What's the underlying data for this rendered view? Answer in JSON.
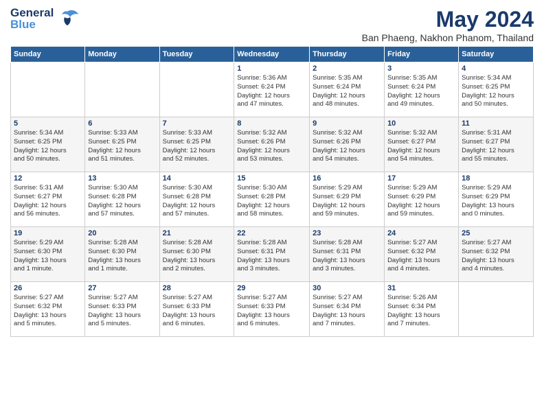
{
  "header": {
    "logo_line1": "General",
    "logo_line2": "Blue",
    "month_year": "May 2024",
    "location": "Ban Phaeng, Nakhon Phanom, Thailand"
  },
  "weekdays": [
    "Sunday",
    "Monday",
    "Tuesday",
    "Wednesday",
    "Thursday",
    "Friday",
    "Saturday"
  ],
  "weeks": [
    {
      "days": [
        {
          "num": "",
          "info": ""
        },
        {
          "num": "",
          "info": ""
        },
        {
          "num": "",
          "info": ""
        },
        {
          "num": "1",
          "info": "Sunrise: 5:36 AM\nSunset: 6:24 PM\nDaylight: 12 hours\nand 47 minutes."
        },
        {
          "num": "2",
          "info": "Sunrise: 5:35 AM\nSunset: 6:24 PM\nDaylight: 12 hours\nand 48 minutes."
        },
        {
          "num": "3",
          "info": "Sunrise: 5:35 AM\nSunset: 6:24 PM\nDaylight: 12 hours\nand 49 minutes."
        },
        {
          "num": "4",
          "info": "Sunrise: 5:34 AM\nSunset: 6:25 PM\nDaylight: 12 hours\nand 50 minutes."
        }
      ]
    },
    {
      "days": [
        {
          "num": "5",
          "info": "Sunrise: 5:34 AM\nSunset: 6:25 PM\nDaylight: 12 hours\nand 50 minutes."
        },
        {
          "num": "6",
          "info": "Sunrise: 5:33 AM\nSunset: 6:25 PM\nDaylight: 12 hours\nand 51 minutes."
        },
        {
          "num": "7",
          "info": "Sunrise: 5:33 AM\nSunset: 6:25 PM\nDaylight: 12 hours\nand 52 minutes."
        },
        {
          "num": "8",
          "info": "Sunrise: 5:32 AM\nSunset: 6:26 PM\nDaylight: 12 hours\nand 53 minutes."
        },
        {
          "num": "9",
          "info": "Sunrise: 5:32 AM\nSunset: 6:26 PM\nDaylight: 12 hours\nand 54 minutes."
        },
        {
          "num": "10",
          "info": "Sunrise: 5:32 AM\nSunset: 6:27 PM\nDaylight: 12 hours\nand 54 minutes."
        },
        {
          "num": "11",
          "info": "Sunrise: 5:31 AM\nSunset: 6:27 PM\nDaylight: 12 hours\nand 55 minutes."
        }
      ]
    },
    {
      "days": [
        {
          "num": "12",
          "info": "Sunrise: 5:31 AM\nSunset: 6:27 PM\nDaylight: 12 hours\nand 56 minutes."
        },
        {
          "num": "13",
          "info": "Sunrise: 5:30 AM\nSunset: 6:28 PM\nDaylight: 12 hours\nand 57 minutes."
        },
        {
          "num": "14",
          "info": "Sunrise: 5:30 AM\nSunset: 6:28 PM\nDaylight: 12 hours\nand 57 minutes."
        },
        {
          "num": "15",
          "info": "Sunrise: 5:30 AM\nSunset: 6:28 PM\nDaylight: 12 hours\nand 58 minutes."
        },
        {
          "num": "16",
          "info": "Sunrise: 5:29 AM\nSunset: 6:29 PM\nDaylight: 12 hours\nand 59 minutes."
        },
        {
          "num": "17",
          "info": "Sunrise: 5:29 AM\nSunset: 6:29 PM\nDaylight: 12 hours\nand 59 minutes."
        },
        {
          "num": "18",
          "info": "Sunrise: 5:29 AM\nSunset: 6:29 PM\nDaylight: 13 hours\nand 0 minutes."
        }
      ]
    },
    {
      "days": [
        {
          "num": "19",
          "info": "Sunrise: 5:29 AM\nSunset: 6:30 PM\nDaylight: 13 hours\nand 1 minute."
        },
        {
          "num": "20",
          "info": "Sunrise: 5:28 AM\nSunset: 6:30 PM\nDaylight: 13 hours\nand 1 minute."
        },
        {
          "num": "21",
          "info": "Sunrise: 5:28 AM\nSunset: 6:30 PM\nDaylight: 13 hours\nand 2 minutes."
        },
        {
          "num": "22",
          "info": "Sunrise: 5:28 AM\nSunset: 6:31 PM\nDaylight: 13 hours\nand 3 minutes."
        },
        {
          "num": "23",
          "info": "Sunrise: 5:28 AM\nSunset: 6:31 PM\nDaylight: 13 hours\nand 3 minutes."
        },
        {
          "num": "24",
          "info": "Sunrise: 5:27 AM\nSunset: 6:32 PM\nDaylight: 13 hours\nand 4 minutes."
        },
        {
          "num": "25",
          "info": "Sunrise: 5:27 AM\nSunset: 6:32 PM\nDaylight: 13 hours\nand 4 minutes."
        }
      ]
    },
    {
      "days": [
        {
          "num": "26",
          "info": "Sunrise: 5:27 AM\nSunset: 6:32 PM\nDaylight: 13 hours\nand 5 minutes."
        },
        {
          "num": "27",
          "info": "Sunrise: 5:27 AM\nSunset: 6:33 PM\nDaylight: 13 hours\nand 5 minutes."
        },
        {
          "num": "28",
          "info": "Sunrise: 5:27 AM\nSunset: 6:33 PM\nDaylight: 13 hours\nand 6 minutes."
        },
        {
          "num": "29",
          "info": "Sunrise: 5:27 AM\nSunset: 6:33 PM\nDaylight: 13 hours\nand 6 minutes."
        },
        {
          "num": "30",
          "info": "Sunrise: 5:27 AM\nSunset: 6:34 PM\nDaylight: 13 hours\nand 7 minutes."
        },
        {
          "num": "31",
          "info": "Sunrise: 5:26 AM\nSunset: 6:34 PM\nDaylight: 13 hours\nand 7 minutes."
        },
        {
          "num": "",
          "info": ""
        }
      ]
    }
  ]
}
